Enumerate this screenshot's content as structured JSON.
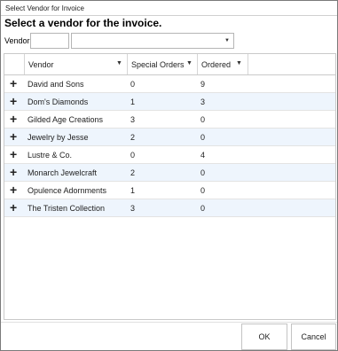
{
  "window": {
    "title": "Select Vendor for Invoice"
  },
  "heading": "Select a vendor for the invoice.",
  "filter": {
    "label": "Vendor",
    "code_value": "",
    "select_value": ""
  },
  "grid": {
    "columns": [
      "Vendor",
      "Special Orders",
      "Ordered"
    ],
    "rows": [
      {
        "vendor": "David and Sons",
        "special_orders": "0",
        "ordered": "9"
      },
      {
        "vendor": "Dom's Diamonds",
        "special_orders": "1",
        "ordered": "3"
      },
      {
        "vendor": "Gilded Age Creations",
        "special_orders": "3",
        "ordered": "0"
      },
      {
        "vendor": "Jewelry by Jesse",
        "special_orders": "2",
        "ordered": "0"
      },
      {
        "vendor": "Lustre & Co.",
        "special_orders": "0",
        "ordered": "4"
      },
      {
        "vendor": "Monarch Jewelcraft",
        "special_orders": "2",
        "ordered": "0"
      },
      {
        "vendor": "Opulence Adornments",
        "special_orders": "1",
        "ordered": "0"
      },
      {
        "vendor": "The Tristen Collection",
        "special_orders": "3",
        "ordered": "0"
      }
    ]
  },
  "buttons": {
    "ok": "OK",
    "cancel": "Cancel"
  },
  "icons": {
    "expand": "plus-icon",
    "filter": "filter-icon",
    "dropdown": "chevron-down-icon"
  }
}
